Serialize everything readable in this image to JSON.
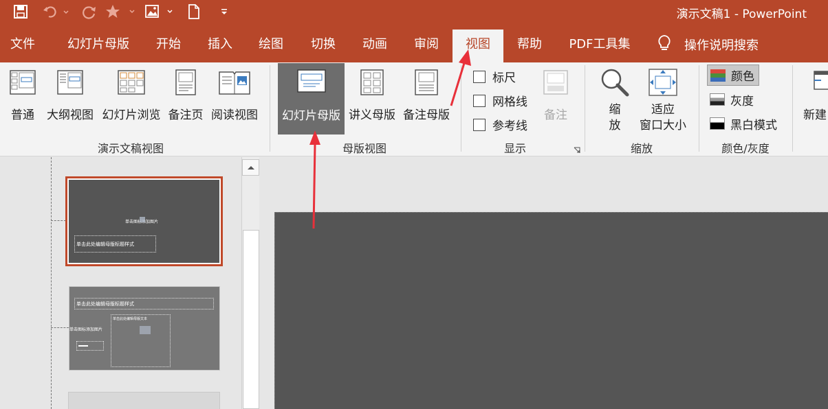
{
  "window": {
    "title": "演示文稿1  -  PowerPoint"
  },
  "quick_access": [
    "save-icon",
    "undo-icon",
    "redo-icon",
    "star-icon",
    "picture-icon",
    "new-doc-icon",
    "customize-icon"
  ],
  "tabs": [
    {
      "label": "文件",
      "active": false
    },
    {
      "label": "幻灯片母版",
      "active": false
    },
    {
      "label": "开始",
      "active": false
    },
    {
      "label": "插入",
      "active": false
    },
    {
      "label": "绘图",
      "active": false
    },
    {
      "label": "切换",
      "active": false
    },
    {
      "label": "动画",
      "active": false
    },
    {
      "label": "审阅",
      "active": false
    },
    {
      "label": "视图",
      "active": true
    },
    {
      "label": "帮助",
      "active": false
    },
    {
      "label": "PDF工具集",
      "active": false
    }
  ],
  "tell_me": {
    "label": "操作说明搜索",
    "icon": "lightbulb-icon"
  },
  "ribbon": {
    "presentation_views": {
      "label": "演示文稿视图",
      "buttons": [
        {
          "label": "普通",
          "icon": "normal-view-icon"
        },
        {
          "label": "大纲视图",
          "icon": "outline-view-icon"
        },
        {
          "label": "幻灯片浏览",
          "icon": "slide-sorter-icon"
        },
        {
          "label": "备注页",
          "icon": "notes-page-icon"
        },
        {
          "label": "阅读视图",
          "icon": "reading-view-icon"
        }
      ]
    },
    "master_views": {
      "label": "母版视图",
      "buttons": [
        {
          "label": "幻灯片母版",
          "icon": "slide-master-icon",
          "selected": true
        },
        {
          "label": "讲义母版",
          "icon": "handout-master-icon",
          "selected": false
        },
        {
          "label": "备注母版",
          "icon": "notes-master-icon",
          "selected": false
        }
      ]
    },
    "show": {
      "label": "显示",
      "checkboxes": [
        {
          "label": "标尺",
          "checked": false
        },
        {
          "label": "网格线",
          "checked": false
        },
        {
          "label": "参考线",
          "checked": false
        }
      ],
      "notes_button": {
        "label": "备注",
        "disabled": true
      }
    },
    "zoom": {
      "label": "缩放",
      "zoom_button": {
        "line1": "缩",
        "line2": "放"
      },
      "fit_button": {
        "line1": "适应",
        "line2": "窗口大小"
      }
    },
    "color_grayscale": {
      "label": "颜色/灰度",
      "options": [
        {
          "label": "颜色",
          "selected": true
        },
        {
          "label": "灰度",
          "selected": false
        },
        {
          "label": "黑白模式",
          "selected": false
        }
      ]
    },
    "window": {
      "new_window_label": "新建"
    }
  },
  "thumbnails": {
    "master": {
      "picture_placeholder": "单击图标添加图片",
      "title_placeholder": "单击此处编辑母版标题样式"
    },
    "layout1": {
      "title_placeholder": "单击此处编辑母版标题样式",
      "picture_placeholder": "单击图标添加图片",
      "text_placeholder": "单击此处编辑母版文本"
    }
  },
  "colors": {
    "accent": "#b7472a",
    "ribbon_bg": "#f3f3f3",
    "slide_bg": "#555555",
    "annotation_arrow": "#e8303a"
  }
}
